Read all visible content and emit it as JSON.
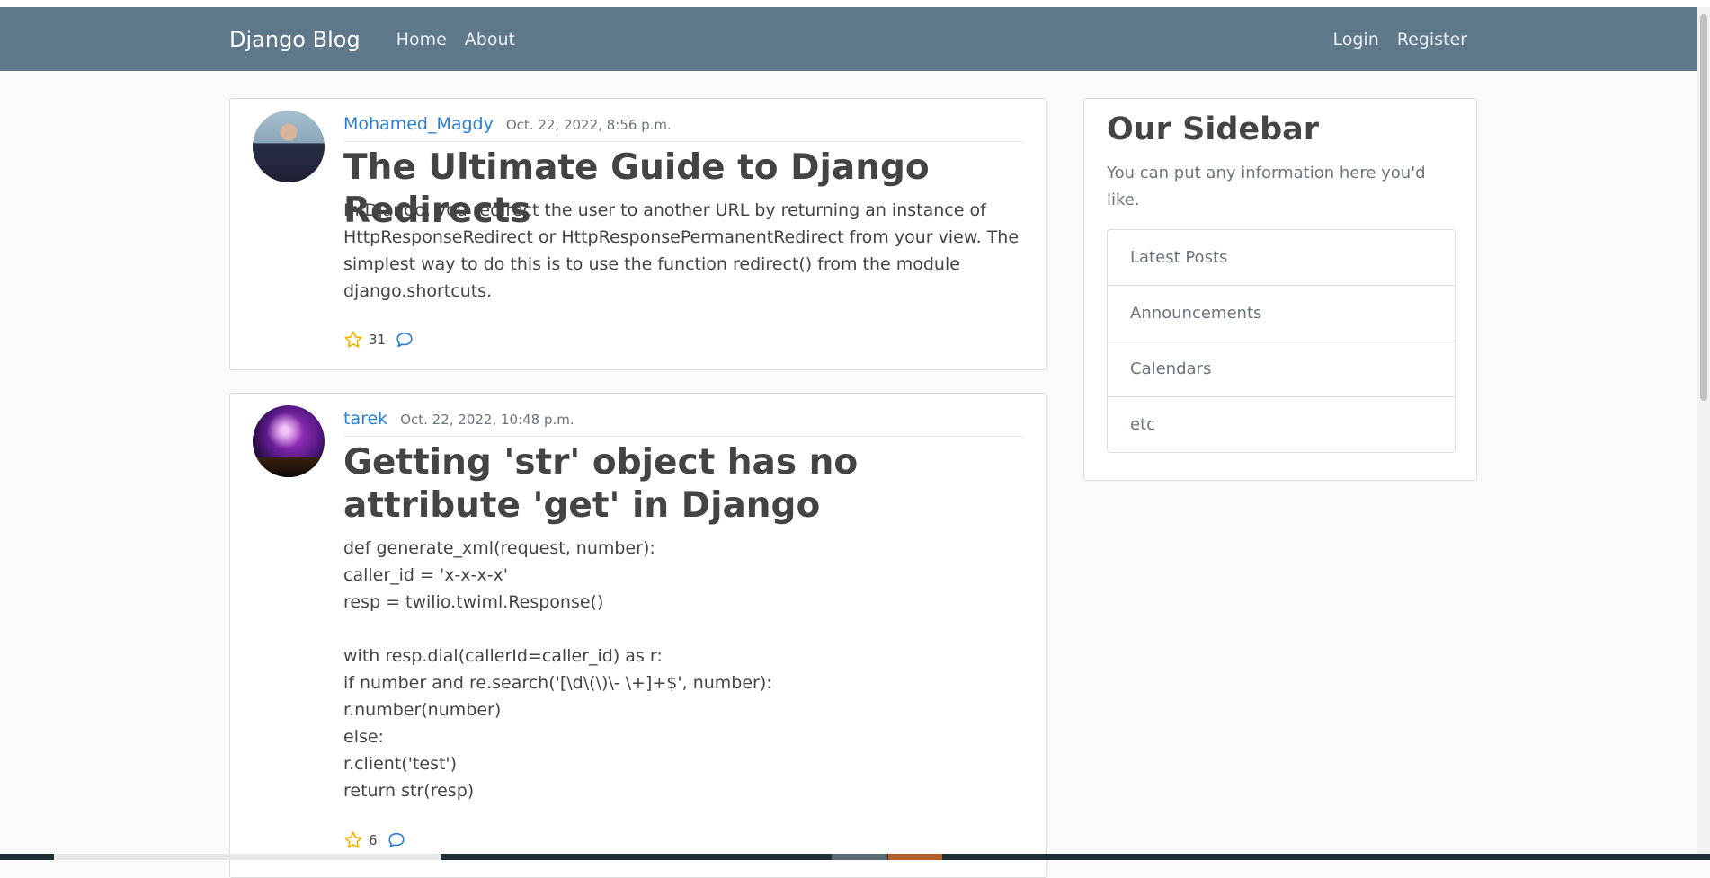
{
  "navbar": {
    "brand": "Django Blog",
    "links": [
      "Home",
      "About"
    ],
    "right_links": [
      "Login",
      "Register"
    ]
  },
  "posts": [
    {
      "author": "Mohamed_Magdy",
      "date": "Oct. 22, 2022, 8:56 p.m.",
      "title": "The Ultimate Guide to Django Redirects",
      "content": "In Django, you redirect the user to another URL by returning an instance of HttpResponseRedirect or HttpResponsePermanentRedirect from your view. The simplest way to do this is to use the function redirect() from the module django.shortcuts.",
      "likes": "31",
      "icons": [
        "star-icon",
        "comment-icon"
      ]
    },
    {
      "author": "tarek",
      "date": "Oct. 22, 2022, 10:48 p.m.",
      "title": "Getting 'str' object has no attribute 'get' in Django",
      "content_lines": [
        "def generate_xml(request, number):",
        "caller_id = 'x-x-x-x'",
        "resp = twilio.twiml.Response()",
        "",
        "with resp.dial(callerId=caller_id) as r:",
        "if number and re.search('[\\d\\(\\)\\- \\+]+$', number):",
        "r.number(number)",
        "else:",
        "r.client('test')",
        "return str(resp)"
      ],
      "likes": "6",
      "icons": [
        "star-icon",
        "comment-icon"
      ]
    }
  ],
  "sidebar": {
    "title": "Our Sidebar",
    "text": "You can put any information here you'd like.",
    "items": [
      "Latest Posts",
      "Announcements",
      "Calendars",
      "etc"
    ]
  },
  "colors": {
    "navbar": "#5f788a",
    "link": "#2b7fd4",
    "star": "#f0b400"
  }
}
